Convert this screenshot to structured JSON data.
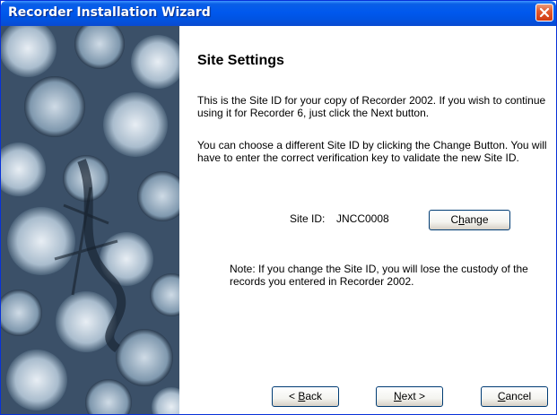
{
  "window": {
    "title": "Recorder Installation Wizard"
  },
  "page": {
    "heading": "Site Settings",
    "paragraph1": "This is the Site ID for your copy of Recorder 2002. If you wish to continue using it for Recorder 6, just click the Next button.",
    "paragraph2": "You can choose a different Site ID by clicking the Change Button. You will have to enter the correct verification key to validate the new Site ID.",
    "site_id_label": "Site ID:",
    "site_id_value": "JNCC0008",
    "change_button": {
      "before": "C",
      "accel": "h",
      "after": "ange"
    },
    "note": "Note: If you change the Site ID, you will lose the custody of the records you entered in Recorder 2002."
  },
  "buttons": {
    "back": {
      "before": "< ",
      "accel": "B",
      "after": "ack"
    },
    "next": {
      "before": "",
      "accel": "N",
      "after": "ext >"
    },
    "cancel": {
      "before": "",
      "accel": "C",
      "after": "ancel"
    }
  },
  "icons": {
    "close": "close-icon",
    "side_image": "wizard-side-image"
  },
  "colors": {
    "titlebar": "#0054e3",
    "close_button": "#e25b2f",
    "button_border": "#003c74"
  }
}
